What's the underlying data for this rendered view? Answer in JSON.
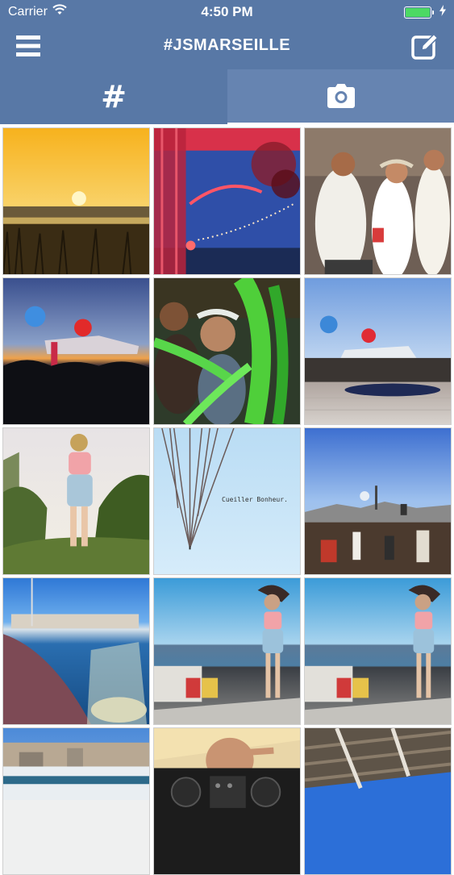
{
  "status": {
    "carrier": "Carrier",
    "time": "4:50 PM"
  },
  "nav": {
    "title": "#JSMARSEILLE",
    "left_icon": "hamburger-menu-icon",
    "right_icon": "compose-icon"
  },
  "tabs": [
    {
      "icon": "hashtag-icon",
      "label": "#",
      "selected": true
    },
    {
      "icon": "camera-icon",
      "selected": false
    }
  ],
  "colors": {
    "bar": "#5878a6",
    "tab_inactive": "#6684b1",
    "battery": "#4cd964"
  },
  "photos": [
    {
      "subject": "sunset over marsh"
    },
    {
      "subject": "red stage with flowers"
    },
    {
      "subject": "party crowd"
    },
    {
      "subject": "balloons over crowd at dusk"
    },
    {
      "subject": "people with green leaves"
    },
    {
      "subject": "balloons over terrace"
    },
    {
      "subject": "girl jumping"
    },
    {
      "subject": "antenna against sky",
      "caption": "Cueiller Bonheur."
    },
    {
      "subject": "crowd by harbor"
    },
    {
      "subject": "harbor view with glass"
    },
    {
      "subject": "woman on terrace"
    },
    {
      "subject": "woman on terrace"
    },
    {
      "subject": "city panorama"
    },
    {
      "subject": "dj at turntables"
    },
    {
      "subject": "pergola roof"
    }
  ]
}
